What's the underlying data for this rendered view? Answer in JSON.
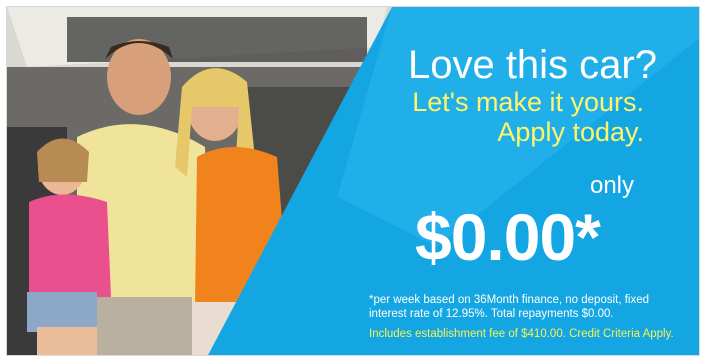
{
  "banner": {
    "headline": "Love this car?",
    "subline_1": "Let's make it yours.",
    "subline_2": "Apply today.",
    "only_label": "only",
    "price": "$0.00*",
    "disclaimer": "*per week based on 36Month finance, no deposit, fixed interest rate of 12.95%. Total repayments $0.00.",
    "fee_note": "Includes establishment fee of $410.00. Credit Criteria Apply."
  },
  "colors": {
    "panel_blue": "#14a6e2",
    "panel_blue_light": "#2cb7ee",
    "accent_yellow": "#fff56b",
    "text_white": "#ffffff"
  }
}
